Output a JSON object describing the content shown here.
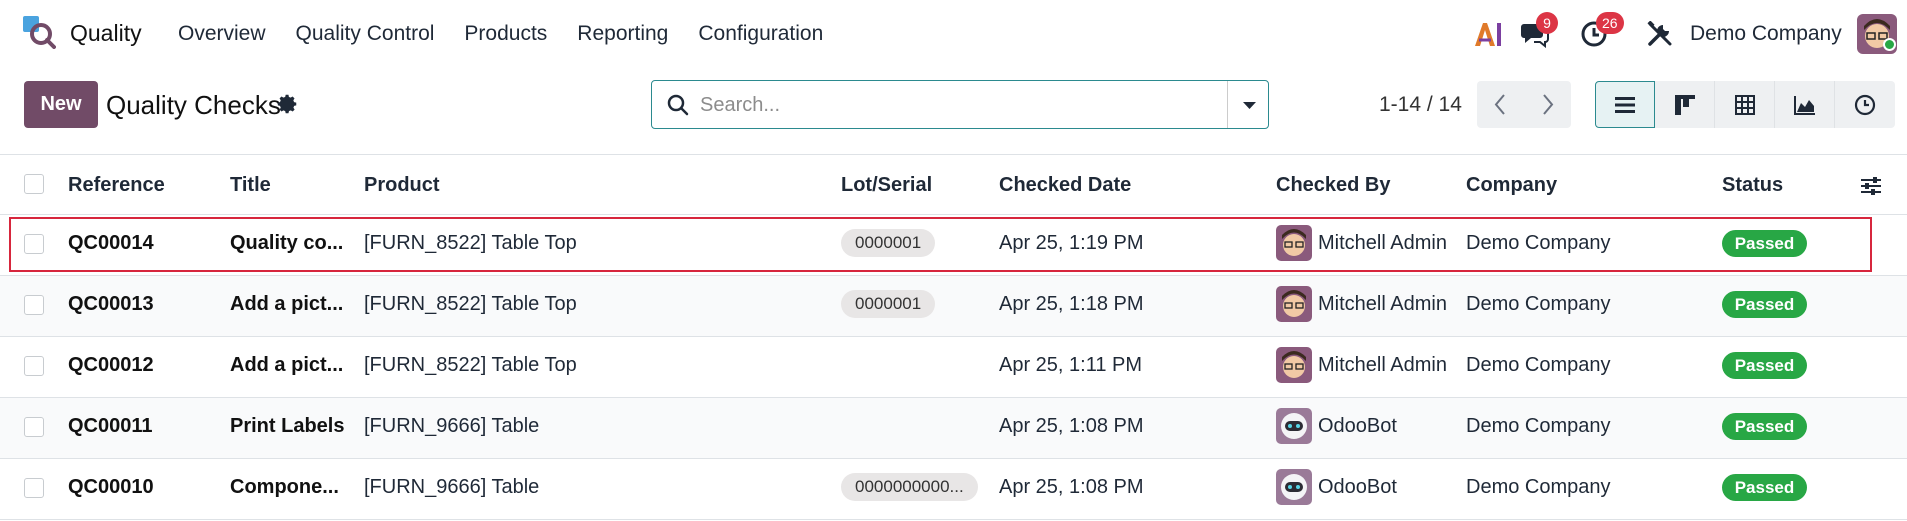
{
  "nav": {
    "app_name": "Quality",
    "menu": [
      "Overview",
      "Quality Control",
      "Products",
      "Reporting",
      "Configuration"
    ],
    "messages_count": "9",
    "activities_count": "26",
    "company": "Demo Company",
    "ai_label": "AI"
  },
  "control": {
    "new_label": "New",
    "title": "Quality Checks",
    "search_placeholder": "Search...",
    "pager": "1-14 / 14"
  },
  "table": {
    "headers": {
      "reference": "Reference",
      "title": "Title",
      "product": "Product",
      "lot": "Lot/Serial",
      "checked_date": "Checked Date",
      "checked_by": "Checked By",
      "company": "Company",
      "status": "Status"
    },
    "rows": [
      {
        "reference": "QC00014",
        "title": "Quality co...",
        "product": "[FURN_8522] Table Top",
        "lot": "0000001",
        "date": "Apr 25, 1:19 PM",
        "checked_by": "Mitchell Admin",
        "company": "Demo Company",
        "status": "Passed"
      },
      {
        "reference": "QC00013",
        "title": "Add a pict...",
        "product": "[FURN_8522] Table Top",
        "lot": "0000001",
        "date": "Apr 25, 1:18 PM",
        "checked_by": "Mitchell Admin",
        "company": "Demo Company",
        "status": "Passed"
      },
      {
        "reference": "QC00012",
        "title": "Add a pict...",
        "product": "[FURN_8522] Table Top",
        "lot": "",
        "date": "Apr 25, 1:11 PM",
        "checked_by": "Mitchell Admin",
        "company": "Demo Company",
        "status": "Passed"
      },
      {
        "reference": "QC00011",
        "title": "Print Labels",
        "product": "[FURN_9666] Table",
        "lot": "",
        "date": "Apr 25, 1:08 PM",
        "checked_by": "OdooBot",
        "company": "Demo Company",
        "status": "Passed"
      },
      {
        "reference": "QC00010",
        "title": "Compone...",
        "product": "[FURN_9666] Table",
        "lot": "0000000000...",
        "date": "Apr 25, 1:08 PM",
        "checked_by": "OdooBot",
        "company": "Demo Company",
        "status": "Passed"
      }
    ]
  },
  "colors": {
    "brand": "#714b67",
    "accent": "#2b8a8f",
    "passed": "#28a745",
    "badge": "#dc3545",
    "highlight": "#d7263d"
  }
}
